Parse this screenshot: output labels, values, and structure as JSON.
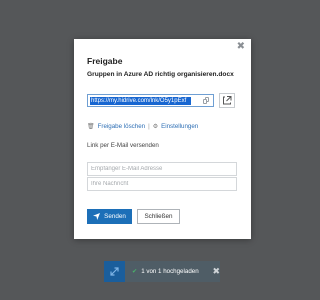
{
  "dialog": {
    "title": "Freigabe",
    "filename": "Gruppen in Azure AD richtig organisieren.docx",
    "close_glyph": "✖",
    "share_link": "https://my.hidrive.com/lnk/O5y1pExf",
    "delete_share_label": "Freigabe löschen",
    "separator": "|",
    "settings_label": "Einstellungen",
    "email_section_label": "Link per E-Mail versenden",
    "recipient_placeholder": "Empfänger E-Mail Adresse",
    "message_placeholder": "Ihre Nachricht",
    "send_label": "Senden",
    "close_label": "Schließen"
  },
  "upload_status": {
    "text": "1 von 1 hochgeladen",
    "check_glyph": "✔",
    "close_glyph": "✖"
  },
  "colors": {
    "accent": "#1c6fb8",
    "link": "#2e6fb5",
    "backdrop": "#555759",
    "toast_bg": "#4f5d66",
    "success": "#49b36a"
  },
  "icons": [
    "close-icon",
    "copy-icon",
    "external-link-icon",
    "trash-icon",
    "gear-icon",
    "send-icon",
    "expand-icon",
    "check-icon"
  ]
}
